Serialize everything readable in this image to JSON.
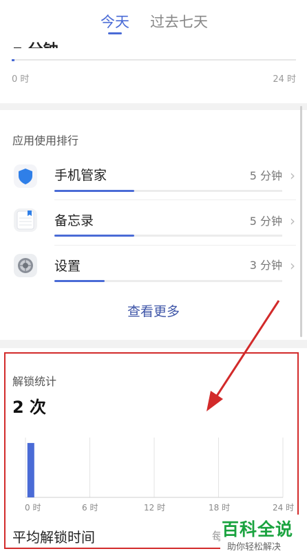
{
  "tabs": [
    {
      "label": "今天",
      "active": true
    },
    {
      "label": "过去七天",
      "active": false
    }
  ],
  "colors": {
    "accent": "#4a6bd6",
    "link": "#3f56a8",
    "annotation": "#d22a2a"
  },
  "screen_time": {
    "partial_title": "▪ 分钟",
    "axis_start": "0 时",
    "axis_end": "24 时"
  },
  "ranking": {
    "title": "应用使用排行",
    "items": [
      {
        "name": "手机管家",
        "time": "5 分钟",
        "icon": "shield-icon",
        "fraction": 0.35
      },
      {
        "name": "备忘录",
        "time": "5 分钟",
        "icon": "notepad-icon",
        "fraction": 0.35
      },
      {
        "name": "设置",
        "time": "3 分钟",
        "icon": "settings-gear-icon",
        "fraction": 0.22
      }
    ],
    "more_label": "查看更多"
  },
  "unlock": {
    "title": "解锁统计",
    "count": "2 次",
    "avg_label": "平均解锁时间",
    "avg_fragment": "每"
  },
  "chart_data": {
    "type": "bar",
    "x_ticks": [
      "0 时",
      "6 时",
      "12 时",
      "18 时",
      "24 时"
    ],
    "xlim": [
      0,
      24
    ],
    "series": [
      {
        "values": [
          {
            "hour": 0.5,
            "unlocks": 2
          }
        ]
      }
    ],
    "grid": true
  },
  "watermark": {
    "main": "百科全说",
    "sub": "助你轻松解决"
  }
}
